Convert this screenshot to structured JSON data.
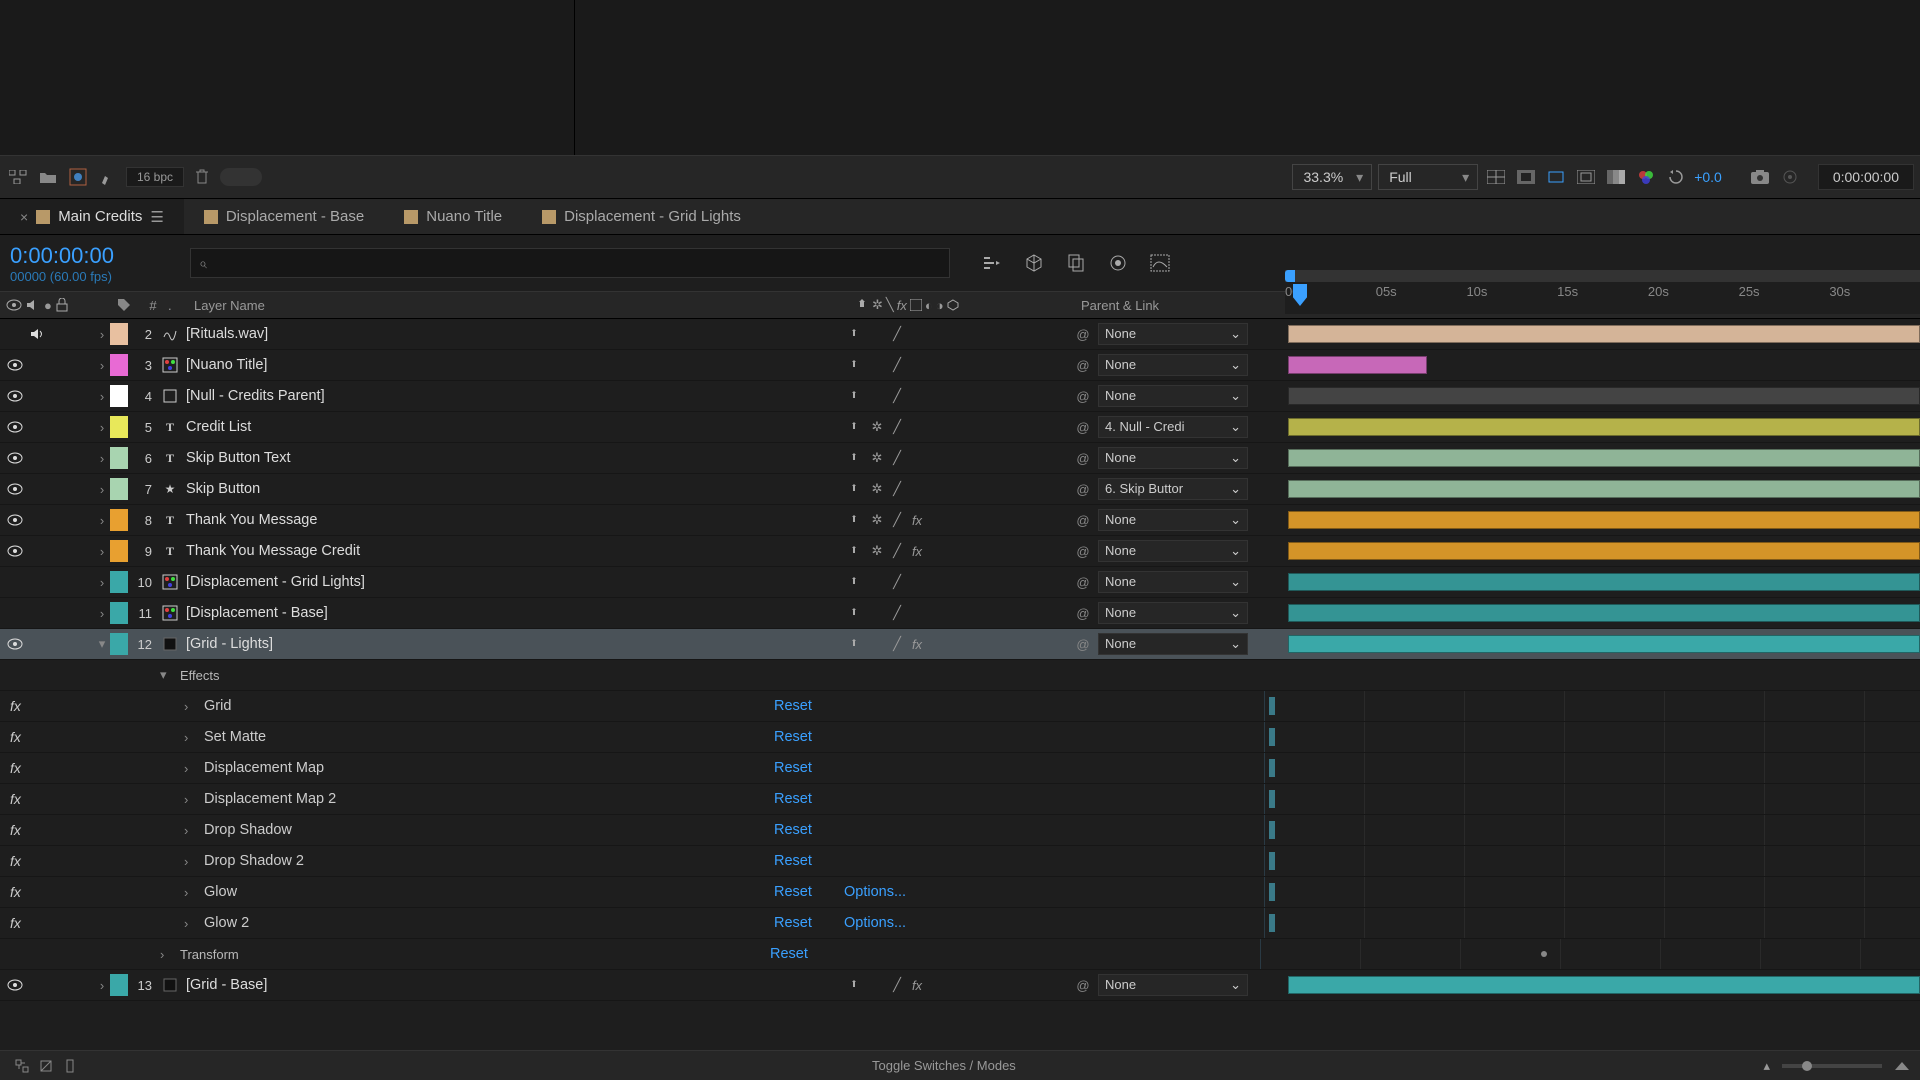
{
  "toolbar": {
    "bpc_label": "16 bpc",
    "zoom": "33.3%",
    "resolution": "Full",
    "exposure": "+0.0",
    "timecode": "0:00:00:00"
  },
  "tabs": [
    {
      "label": "Main Credits",
      "active": true,
      "closable": true,
      "menu": true
    },
    {
      "label": "Displacement - Base",
      "active": false
    },
    {
      "label": "Nuano Title",
      "active": false
    },
    {
      "label": "Displacement - Grid Lights",
      "active": false
    }
  ],
  "time": {
    "current": "0:00:00:00",
    "frame_info": "00000 (60.00 fps)"
  },
  "ruler": [
    "00s",
    "05s",
    "10s",
    "15s",
    "20s",
    "25s",
    "30s"
  ],
  "columns": {
    "hash": "#",
    "layer_name": "Layer Name",
    "parent_link": "Parent & Link"
  },
  "layers": [
    {
      "num": 2,
      "name": "[Rituals.wav]",
      "type": "audio",
      "color": "#e8c0a0",
      "bar_color": "#d4b498",
      "bar_start": 0,
      "bar_end": 100,
      "audio": true,
      "video": false,
      "parent": "None",
      "fx": false,
      "star": false
    },
    {
      "num": 3,
      "name": "[Nuano Title]",
      "type": "comp",
      "color": "#e86ad4",
      "bar_color": "#c768b8",
      "bar_start": 0,
      "bar_end": 22,
      "audio": false,
      "video": true,
      "parent": "None",
      "fx": false,
      "star": false
    },
    {
      "num": 4,
      "name": "[Null - Credits Parent]",
      "type": "null",
      "color": "#ffffff",
      "bar_color": "#444",
      "bar_start": 0,
      "bar_end": 100,
      "audio": false,
      "video": true,
      "parent": "None",
      "fx": false,
      "star": false
    },
    {
      "num": 5,
      "name": "Credit List",
      "type": "text",
      "color": "#e8e85a",
      "bar_color": "#b5b24a",
      "bar_start": 0,
      "bar_end": 100,
      "audio": false,
      "video": true,
      "parent": "4. Null - Credi",
      "fx": false,
      "star": true
    },
    {
      "num": 6,
      "name": "Skip Button Text",
      "type": "text",
      "color": "#a8d4b0",
      "bar_color": "#8fb497",
      "bar_start": 0,
      "bar_end": 100,
      "audio": false,
      "video": true,
      "parent": "None",
      "fx": false,
      "star": true
    },
    {
      "num": 7,
      "name": "Skip Button",
      "type": "shape",
      "color": "#a8d4b0",
      "bar_color": "#8fb497",
      "bar_start": 0,
      "bar_end": 100,
      "audio": false,
      "video": true,
      "parent": "6. Skip Buttor",
      "fx": false,
      "star": true
    },
    {
      "num": 8,
      "name": "Thank You Message",
      "type": "text",
      "color": "#e8a030",
      "bar_color": "#d49428",
      "bar_start": 0,
      "bar_end": 100,
      "audio": false,
      "video": true,
      "parent": "None",
      "fx": true,
      "star": true
    },
    {
      "num": 9,
      "name": "Thank You Message Credit",
      "type": "text",
      "color": "#e8a030",
      "bar_color": "#d49428",
      "bar_start": 0,
      "bar_end": 100,
      "audio": false,
      "video": true,
      "parent": "None",
      "fx": true,
      "star": true
    },
    {
      "num": 10,
      "name": "[Displacement - Grid Lights]",
      "type": "comp",
      "color": "#3aa8a8",
      "bar_color": "#349494",
      "bar_start": 0,
      "bar_end": 100,
      "audio": false,
      "video": false,
      "parent": "None",
      "fx": false,
      "star": false
    },
    {
      "num": 11,
      "name": "[Displacement - Base]",
      "type": "comp",
      "color": "#3aa8a8",
      "bar_color": "#349494",
      "bar_start": 0,
      "bar_end": 100,
      "audio": false,
      "video": false,
      "parent": "None",
      "fx": false,
      "star": false
    },
    {
      "num": 12,
      "name": "[Grid - Lights]",
      "type": "solid",
      "color": "#3aa8a8",
      "bar_color": "#3aa8a8",
      "bar_start": 0,
      "bar_end": 100,
      "audio": false,
      "video": true,
      "parent": "None",
      "fx": true,
      "star": false,
      "selected": true,
      "expanded": true
    },
    {
      "num": 13,
      "name": "[Grid - Base]",
      "type": "solid",
      "color": "#3aa8a8",
      "bar_color": "#3aa8a8",
      "bar_start": 0,
      "bar_end": 100,
      "audio": false,
      "video": true,
      "parent": "None",
      "fx": true,
      "star": false
    }
  ],
  "effects_section_label": "Effects",
  "transform_section_label": "Transform",
  "effects": [
    {
      "name": "Grid",
      "reset": "Reset",
      "options": ""
    },
    {
      "name": "Set Matte",
      "reset": "Reset",
      "options": ""
    },
    {
      "name": "Displacement Map",
      "reset": "Reset",
      "options": ""
    },
    {
      "name": "Displacement Map 2",
      "reset": "Reset",
      "options": ""
    },
    {
      "name": "Drop Shadow",
      "reset": "Reset",
      "options": ""
    },
    {
      "name": "Drop Shadow 2",
      "reset": "Reset",
      "options": ""
    },
    {
      "name": "Glow",
      "reset": "Reset",
      "options": "Options..."
    },
    {
      "name": "Glow 2",
      "reset": "Reset",
      "options": "Options..."
    }
  ],
  "transform_reset": "Reset",
  "footer": {
    "toggle_label": "Toggle Switches / Modes"
  }
}
